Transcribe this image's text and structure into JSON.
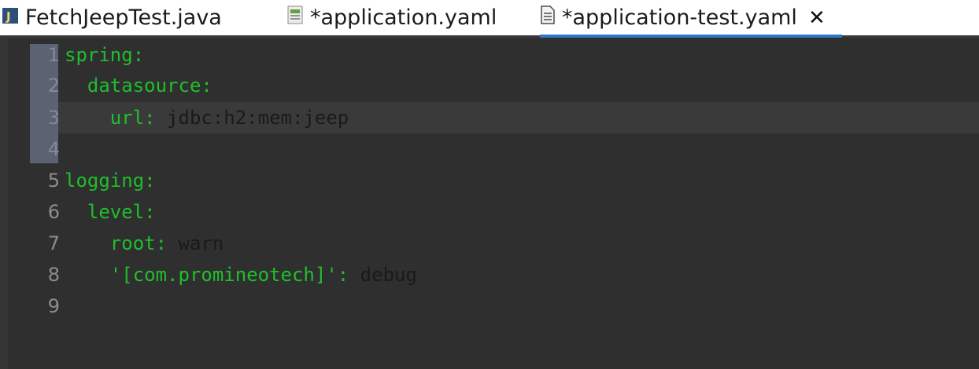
{
  "tabs": [
    {
      "label": "FetchJeepTest.java",
      "icon": "java-file-icon",
      "active": false
    },
    {
      "label": "*application.yaml",
      "icon": "yaml-file-icon",
      "active": false
    },
    {
      "label": "*application-test.yaml",
      "icon": "text-file-icon",
      "active": true
    }
  ],
  "close_symbol": "✕",
  "editor": {
    "lines": [
      {
        "num": "1",
        "indent": "",
        "key": "spring:",
        "value": ""
      },
      {
        "num": "2",
        "indent": "  ",
        "key": "datasource:",
        "value": ""
      },
      {
        "num": "3",
        "indent": "    ",
        "key": "url:",
        "value": " jdbc:h2:mem:jeep"
      },
      {
        "num": "4",
        "indent": "",
        "key": "",
        "value": ""
      },
      {
        "num": "5",
        "indent": "",
        "key": "logging:",
        "value": ""
      },
      {
        "num": "6",
        "indent": "  ",
        "key": "level:",
        "value": ""
      },
      {
        "num": "7",
        "indent": "    ",
        "key": "root:",
        "value": " warn"
      },
      {
        "num": "8",
        "indent": "    ",
        "key": "'[com.promineotech]':",
        "value": " debug"
      },
      {
        "num": "9",
        "indent": "",
        "key": "",
        "value": ""
      }
    ],
    "current_line": 3,
    "colors": {
      "background": "#2f2f2f",
      "key": "#1fbf2b",
      "value": "#1a1a1a",
      "line_number": "#8d8d8d",
      "quick_diff": "#5b6271",
      "active_tab_underline": "#2e78c7"
    }
  }
}
